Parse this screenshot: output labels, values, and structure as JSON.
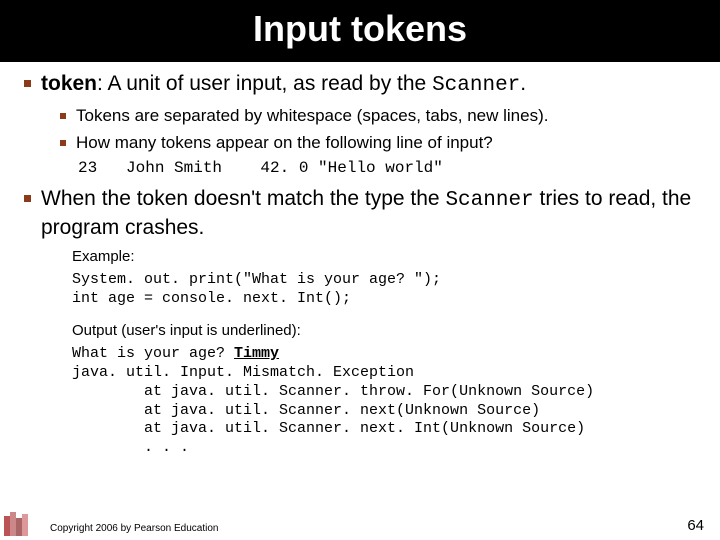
{
  "header": {
    "title": "Input tokens"
  },
  "main": {
    "bullet1_prefix": "token",
    "bullet1_mid": ": A unit of user input, as read by the ",
    "bullet1_code": "Scanner",
    "bullet1_suffix": ".",
    "sub1": "Tokens are separated by whitespace (spaces, tabs, new lines).",
    "sub2": "How many tokens appear on the following line of input?",
    "sub2_code": "23   John Smith    42. 0 \"Hello world\"",
    "bullet2_pre": "When the token doesn't match the type the ",
    "bullet2_code": "Scanner",
    "bullet2_post": " tries to read, the program crashes."
  },
  "example": {
    "label": "Example:",
    "code": "System. out. print(\"What is your age? \");\nint age = console. next. Int();",
    "output_label": "Output (user's input is underlined):",
    "out_prompt": "What is your age? ",
    "out_input": "Timmy",
    "out_trace": "java. util. Input. Mismatch. Exception\n        at java. util. Scanner. throw. For(Unknown Source)\n        at java. util. Scanner. next(Unknown Source)\n        at java. util. Scanner. next. Int(Unknown Source)\n        . . ."
  },
  "footer": {
    "copyright": "Copyright 2006 by Pearson Education",
    "page": "64"
  }
}
